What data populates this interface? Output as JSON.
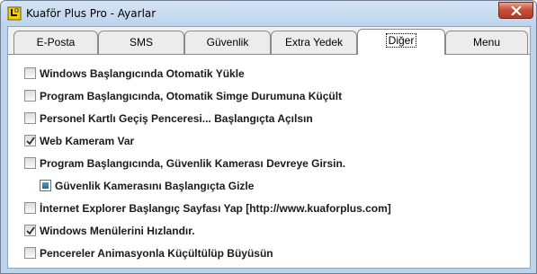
{
  "window": {
    "title": "Kuaför Plus Pro - Ayarlar"
  },
  "tabs": [
    {
      "label": "E-Posta",
      "active": false
    },
    {
      "label": "SMS",
      "active": false
    },
    {
      "label": "Güvenlik",
      "active": false
    },
    {
      "label": "Extra Yedek",
      "active": false
    },
    {
      "label": "Diğer",
      "active": true
    },
    {
      "label": "Menu",
      "active": false
    }
  ],
  "options": [
    {
      "label": "Windows Başlangıcında Otomatik Yükle",
      "checked": false
    },
    {
      "label": "Program Başlangıcında, Otomatik Simge Durumuna Küçült",
      "checked": false
    },
    {
      "label": "Personel Kartlı Geçiş Penceresi... Başlangıçta Açılsın",
      "checked": false
    },
    {
      "label": "Web Kameram Var",
      "checked": true
    },
    {
      "label": "Program Başlangıcında, Güvenlik Kamerası Devreye Girsin.",
      "checked": false
    },
    {
      "label": "Güvenlik Kamerasını Başlangıçta Gizle",
      "checked": "indeterminate"
    },
    {
      "label": "İnternet Explorer Başlangıç Sayfası Yap [http://www.kuaforplus.com]",
      "checked": false
    },
    {
      "label": "Windows Menülerini Hızlandır.",
      "checked": true
    },
    {
      "label": "Pencereler Animasyonla Küçültülüp Büyüsün",
      "checked": false
    }
  ],
  "icons": {
    "app": "app-icon",
    "close": "close-icon",
    "check": "check-icon"
  },
  "colors": {
    "titlebar": "#bcd3ec",
    "close": "#c7503a",
    "panel": "#ffffff"
  }
}
